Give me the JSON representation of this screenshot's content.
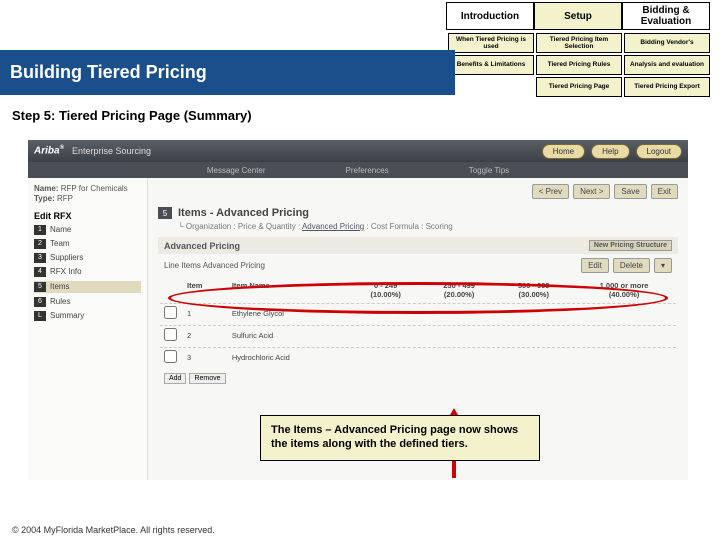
{
  "topnav": {
    "intro": "Introduction",
    "setup": "Setup",
    "bidding": "Bidding & Evaluation"
  },
  "subnav": {
    "r1c1": "When Tiered Pricing is used",
    "r1c2": "Tiered Pricing Item Selection",
    "r1c3": "Bidding Vendor's",
    "r2c1": "Benefits & Limitations",
    "r2c2": "Tiered Pricing Rules",
    "r2c3": "Analysis and evaluation",
    "r3c2": "Tiered Pricing Page",
    "r3c3": "Tiered Pricing Export"
  },
  "banner": "Building Tiered Pricing",
  "section_head": "Step 5: Tiered Pricing Page (Summary)",
  "ariba": {
    "logo_a": "Ariba",
    "logo_b": "Enterprise Sourcing",
    "btn_home": "Home",
    "btn_help": "Help",
    "btn_logout": "Logout",
    "bar2_a": "Message Center",
    "bar2_b": "Preferences",
    "bar2_c": "Toggle Tips",
    "rfp_name_label": "Name:",
    "rfp_name": "RFP for Chemicals",
    "rfp_type_label": "Type:",
    "rfp_type": "RFP",
    "editrfx": "Edit RFX",
    "steps": {
      "s1": "Name",
      "s2": "Team",
      "s3": "Suppliers",
      "s4": "RFX Info",
      "s5": "Items",
      "s6": "Rules",
      "sL": "Summary"
    },
    "top_prev": "< Prev",
    "top_next": "Next >",
    "top_save": "Save",
    "top_exit": "Exit",
    "sec_num": "5",
    "sec_text": "Items - Advanced Pricing",
    "bc_org": "Organization",
    "bc_pq": "Price & Quantity",
    "bc_ap": "Advanced Pricing",
    "bc_cf": "Cost Formula",
    "bc_sc": "Scoring",
    "sub_ap": "Advanced Pricing",
    "btn_newstruct": "New Pricing Structure",
    "sub_line": "Line Items Advanced Pricing",
    "btn_edit": "Edit",
    "btn_delete": "Delete",
    "th_item": "Item",
    "th_name": "Item Name",
    "tier1a": "0 - 249",
    "tier1b": "(10.00%)",
    "tier2a": "250 - 499",
    "tier2b": "(20.00%)",
    "tier3a": "500 - 999",
    "tier3b": "(30.00%)",
    "tier4a": "1,000 or more",
    "tier4b": "(40.00%)",
    "r1_i": "1",
    "r1_n": "Ethylene Glycol",
    "r2_i": "2",
    "r2_n": "Sulfuric Acid",
    "r3_i": "3",
    "r3_n": "Hydrochloric Acid",
    "btn_add": "Add",
    "btn_remove": "Remove"
  },
  "callout": "The Items – Advanced Pricing page now shows the items along with the defined tiers.",
  "footer": "© 2004 MyFlorida MarketPlace. All rights reserved."
}
